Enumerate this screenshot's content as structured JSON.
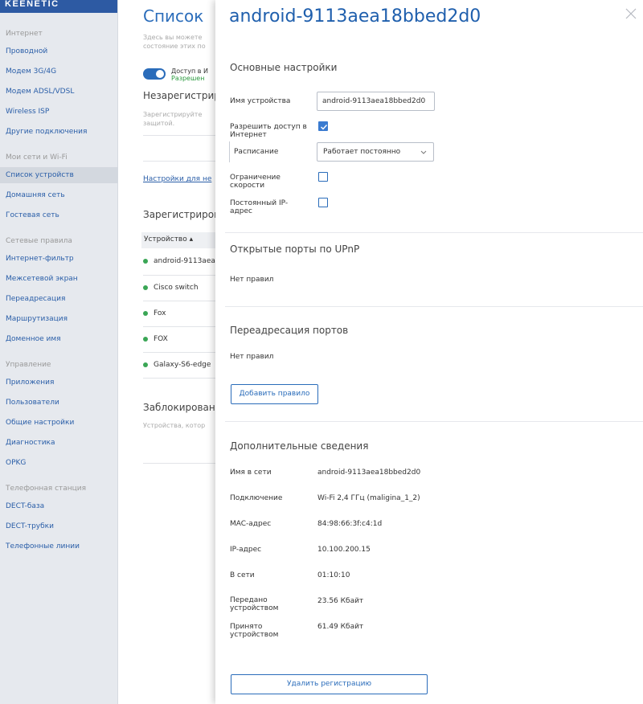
{
  "brand": "KEENETIC",
  "sidebar": {
    "groups": [
      "Интернет",
      "Мои сети и Wi-Fi",
      "Сетевые правила",
      "Управление",
      "Телефонная станция"
    ],
    "items": [
      "Проводной",
      "Модем 3G/4G",
      "Модем ADSL/VDSL",
      "Wireless ISP",
      "Другие подключения",
      "Список устройств",
      "Домашняя сеть",
      "Гостевая сеть",
      "Интернет-фильтр",
      "Межсетевой экран",
      "Переадресация",
      "Маршрутизация",
      "Доменное имя",
      "Приложения",
      "Пользователи",
      "Общие настройки",
      "Диагностика",
      "OPKG",
      "DECT-база",
      "DECT-трубки",
      "Телефонные линии"
    ],
    "active_index": 5
  },
  "background_page": {
    "title": "Список",
    "subtitle_1": "Здесь вы можете",
    "subtitle_2": "состояние этих по",
    "toggle_label": "Доступ в И",
    "toggle_state": "Разрешен",
    "unregistered_title": "Незарегистрир",
    "unregistered_sub_1": "Зарегистрируйте",
    "unregistered_sub_2": "защитой.",
    "settings_link": "Настройки для не",
    "registered_title": "Зарегистриров",
    "table_header": "Устройство ▴",
    "rows": [
      "android-9113aea",
      "Cisco switch",
      "Fox",
      "FOX",
      "Galaxy-S6-edge"
    ],
    "blocked_title": "Заблокированн",
    "blocked_sub": "Устройства, котор"
  },
  "panel": {
    "title": "android-9113aea18bbed2d0",
    "basic": {
      "heading": "Основные настройки",
      "device_name_label": "Имя устройства",
      "device_name_value": "android-9113aea18bbed2d0",
      "allow_internet_label": "Разрешить доступ в Интернет",
      "allow_internet_checked": true,
      "schedule_label": "Расписание",
      "schedule_value": "Работает постоянно",
      "speed_limit_label": "Ограничение скорости",
      "speed_limit_checked": false,
      "static_ip_label": "Постоянный IP-адрес",
      "static_ip_checked": false
    },
    "upnp": {
      "heading": "Открытые порты по UPnP",
      "empty": "Нет правил"
    },
    "port_forward": {
      "heading": "Переадресация портов",
      "empty": "Нет правил",
      "add_button": "Добавить правило"
    },
    "info": {
      "heading": "Дополнительные сведения",
      "rows": [
        {
          "label": "Имя в сети",
          "value": "android-9113aea18bbed2d0"
        },
        {
          "label": "Подключение",
          "value": "Wi-Fi 2,4 ГГц (maligina_1_2)"
        },
        {
          "label": "MAC-адрес",
          "value": "84:98:66:3f:c4:1d"
        },
        {
          "label": "IP-адрес",
          "value": "10.100.200.15"
        },
        {
          "label": "В сети",
          "value": "01:10:10"
        },
        {
          "label": "Передано устройством",
          "value": "23.56 Кбайт"
        },
        {
          "label": "Принято устройством",
          "value": "61.49 Кбайт"
        }
      ]
    },
    "unregister_button": "Удалить регистрацию"
  }
}
